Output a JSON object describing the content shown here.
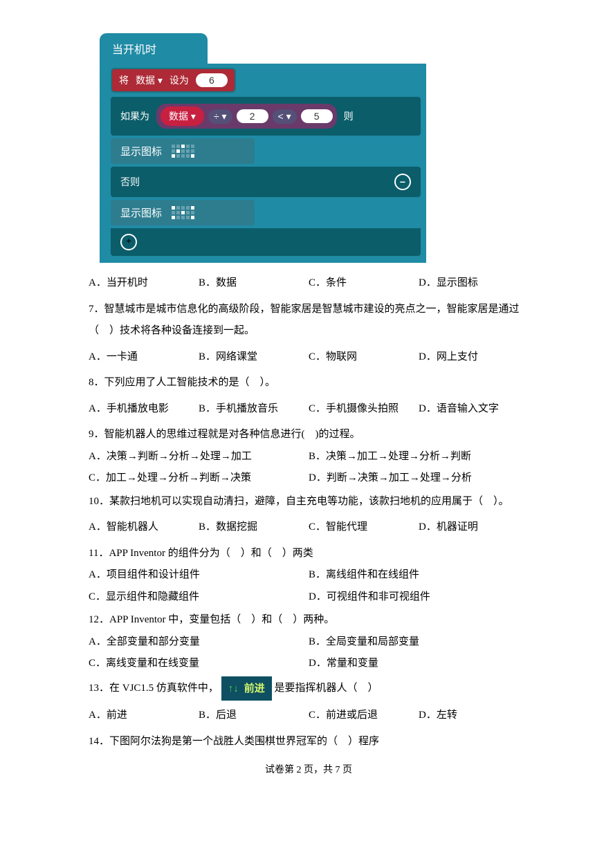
{
  "block": {
    "hat": "当开机时",
    "set_a": "将",
    "set_var": "数据 ▾",
    "set_b": "设为",
    "set_val": "6",
    "if_label": "如果为",
    "cond_var": "数据 ▾",
    "op_div": "÷ ▾",
    "op_v2": "2",
    "op_cmp": "< ▾",
    "op_v5": "5",
    "then": "则",
    "show": "显示图标",
    "else": "否则",
    "minus": "−",
    "plus": "+"
  },
  "q6": {
    "A": "A．当开机时",
    "B": "B．数据",
    "C": "C．条件",
    "D": "D．显示图标"
  },
  "q7": {
    "stem": "7．智慧城市是城市信息化的高级阶段，智能家居是智慧城市建设的亮点之一，智能家居是通过（　）技术将各种设备连接到一起。",
    "A": "A．一卡通",
    "B": "B．网络课堂",
    "C": "C．物联网",
    "D": "D．网上支付"
  },
  "q8": {
    "stem": "8．下列应用了人工智能技术的是（　）。",
    "A": "A．手机播放电影",
    "B": "B．手机播放音乐",
    "C": "C．手机摄像头拍照",
    "D": "D．语音输入文字"
  },
  "q9": {
    "stem": "9．智能机器人的思维过程就是对各种信息进行(　)的过程。",
    "A": "A．决策→判断→分析→处理→加工",
    "B": "B．决策→加工→处理→分析→判断",
    "C": "C．加工→处理→分析→判断→决策",
    "D": "D．判断→决策→加工→处理→分析"
  },
  "q10": {
    "stem": "10．某款扫地机可以实现自动清扫，避障，自主充电等功能，该款扫地机的应用属于（　）。",
    "A": "A．智能机器人",
    "B": "B．数据挖掘",
    "C": "C．智能代理",
    "D": "D．机器证明"
  },
  "q11": {
    "stem": "11．APP Inventor 的组件分为（　）和（　）两类",
    "A": "A．项目组件和设计组件",
    "B": "B．离线组件和在线组件",
    "C": "C．显示组件和隐藏组件",
    "D": "D．可视组件和非可视组件"
  },
  "q12": {
    "stem": "12．APP Inventor 中，变量包括（　）和（　）两种。",
    "A": "A．全部变量和部分变量",
    "B": "B．全局变量和局部变量",
    "C": "C．离线变量和在线变量",
    "D": "D．常量和变量"
  },
  "q13": {
    "pre": "13．在 VJC1.5 仿真软件中，",
    "btn_arrow": "↑↓",
    "btn_label": "前进",
    "post": " 是要指挥机器人（　）",
    "A": "A．前进",
    "B": "B．后退",
    "C": "C．前进或后退",
    "D": "D．左转"
  },
  "q14": {
    "stem": "14．下图阿尔法狗是第一个战胜人类围棋世界冠军的（　）程序"
  },
  "footer": "试卷第 2 页，共 7 页"
}
